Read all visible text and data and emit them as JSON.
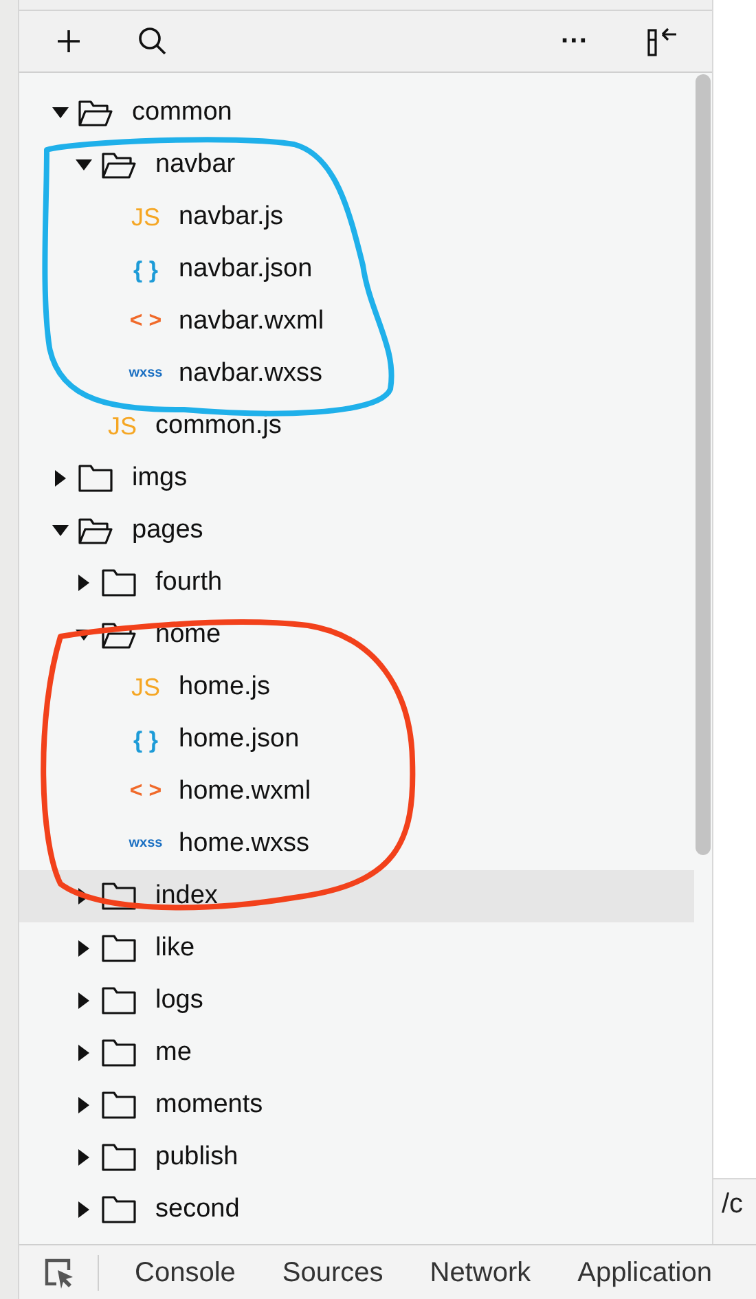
{
  "toolbar": {
    "more": "···"
  },
  "tree": [
    {
      "kind": "folder",
      "name": "common",
      "expanded": true,
      "selected": false,
      "children": [
        {
          "kind": "folder",
          "name": "navbar",
          "expanded": true,
          "selected": false,
          "children": [
            {
              "kind": "js",
              "badge": "JS",
              "name": "navbar.js",
              "selected": false
            },
            {
              "kind": "json",
              "badge": "{ }",
              "name": "navbar.json",
              "selected": false
            },
            {
              "kind": "wxml",
              "badge": "< >",
              "name": "navbar.wxml",
              "selected": false
            },
            {
              "kind": "wxss",
              "badge": "wxss",
              "name": "navbar.wxss",
              "selected": false
            }
          ]
        },
        {
          "kind": "js",
          "badge": "JS",
          "name": "common.js",
          "selected": false
        }
      ]
    },
    {
      "kind": "folder",
      "name": "imgs",
      "expanded": false,
      "selected": false
    },
    {
      "kind": "folder",
      "name": "pages",
      "expanded": true,
      "selected": false,
      "children": [
        {
          "kind": "folder",
          "name": "fourth",
          "expanded": false,
          "selected": false
        },
        {
          "kind": "folder",
          "name": "home",
          "expanded": true,
          "selected": false,
          "children": [
            {
              "kind": "js",
              "badge": "JS",
              "name": "home.js",
              "selected": false
            },
            {
              "kind": "json",
              "badge": "{ }",
              "name": "home.json",
              "selected": false
            },
            {
              "kind": "wxml",
              "badge": "< >",
              "name": "home.wxml",
              "selected": false
            },
            {
              "kind": "wxss",
              "badge": "wxss",
              "name": "home.wxss",
              "selected": false
            }
          ]
        },
        {
          "kind": "folder",
          "name": "index",
          "expanded": false,
          "selected": true
        },
        {
          "kind": "folder",
          "name": "like",
          "expanded": false,
          "selected": false
        },
        {
          "kind": "folder",
          "name": "logs",
          "expanded": false,
          "selected": false
        },
        {
          "kind": "folder",
          "name": "me",
          "expanded": false,
          "selected": false
        },
        {
          "kind": "folder",
          "name": "moments",
          "expanded": false,
          "selected": false
        },
        {
          "kind": "folder",
          "name": "publish",
          "expanded": false,
          "selected": false
        },
        {
          "kind": "folder",
          "name": "second",
          "expanded": false,
          "selected": false
        }
      ]
    }
  ],
  "annotations": [
    {
      "color": "#1fb0ea"
    },
    {
      "color": "#f2411b"
    }
  ],
  "side_text": "/c",
  "bottom_tabs": [
    {
      "label": "Console",
      "selected": false
    },
    {
      "label": "Sources",
      "selected": false
    },
    {
      "label": "Network",
      "selected": false
    },
    {
      "label": "Application",
      "selected": false
    }
  ]
}
